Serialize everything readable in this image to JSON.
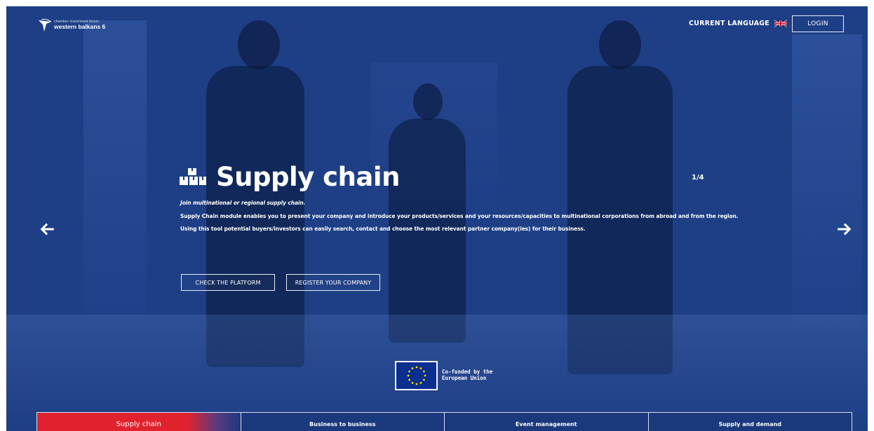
{
  "header": {
    "logo_small": "chamber investment forum",
    "logo_big": "western balkans 6",
    "language_label": "CURRENT LANGUAGE",
    "language_flag": "uk-flag-icon",
    "login_label": "LOGIN"
  },
  "slide": {
    "title": "Supply chain",
    "icon": "boxes-icon",
    "counter": "1/4",
    "tagline": "Join multinational or regional supply chain.",
    "line1": "Supply Chain module enables you to present your company and introduce your products/services and your resources/capacities to multinational corporations from abroad and from the region.",
    "line2": "Using this tool potential buyers/investors can easily search, contact and choose the most relevant partner company(ies) for their business.",
    "cta_primary": "CHECK THE PLATFORM",
    "cta_secondary": "REGISTER YOUR COMPANY"
  },
  "navigation": {
    "prev_icon": "arrow-left-icon",
    "next_icon": "arrow-right-icon"
  },
  "eu": {
    "line1": "Co-funded by the",
    "line2": "European Union"
  },
  "tabs": [
    {
      "label": "Supply chain"
    },
    {
      "label": "Business to business"
    },
    {
      "label": "Event management"
    },
    {
      "label": "Supply and demand"
    }
  ],
  "colors": {
    "hero_bg": "#1e3f86",
    "active_tab": "#e0222e",
    "eu_blue": "#0a2f8e"
  }
}
